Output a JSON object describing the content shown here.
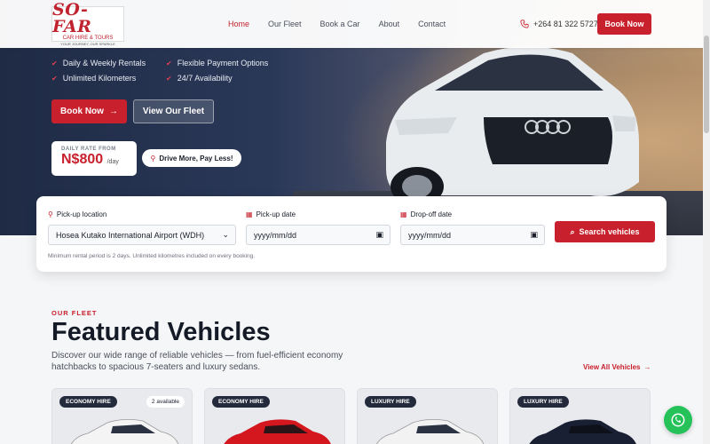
{
  "brand": {
    "logo_text": "SO-FAR",
    "logo_sub": "CAR HIRE & TOURS",
    "logo_tag": "YOUR JOURNEY, OUR SPARKLE"
  },
  "nav": {
    "links": [
      "Home",
      "Our Fleet",
      "Book a Car",
      "About",
      "Contact"
    ],
    "phone": "+264 81 322 5727",
    "cta": "Book Now"
  },
  "hero": {
    "features": [
      "Daily & Weekly Rentals",
      "Flexible Payment Options",
      "Unlimited Kilometers",
      "24/7 Availability"
    ],
    "book_label": "Book Now",
    "fleet_label": "View Our Fleet",
    "rate_label": "DAILY RATE FROM",
    "rate_value": "N$800",
    "rate_unit": "/day",
    "tagline": "Drive More, Pay Less!"
  },
  "search": {
    "pickup_location_label": "Pick-up location",
    "pickup_location_value": "Hosea Kutako International Airport (WDH)",
    "pickup_date_label": "Pick-up date",
    "pickup_date_placeholder": "yyyy/mm/dd",
    "dropoff_date_label": "Drop-off date",
    "dropoff_date_placeholder": "yyyy/mm/dd",
    "submit_label": "Search vehicles",
    "note": "Minimum rental period is 2 days. Unlimited kilometres included on every booking."
  },
  "fleet": {
    "eyebrow": "OUR FLEET",
    "title": "Featured Vehicles",
    "description": "Discover our wide range of reliable vehicles — from fuel-efficient economy hatchbacks to spacious 7-seaters and luxury sedans.",
    "view_all": "View All Vehicles",
    "cards": [
      {
        "badge": "ECONOMY HIRE",
        "availability": "2 available",
        "color": "#f4f4f4"
      },
      {
        "badge": "ECONOMY HIRE",
        "availability": "",
        "color": "#d4161f"
      },
      {
        "badge": "LUXURY HIRE",
        "availability": "",
        "color": "#f2f2f2"
      },
      {
        "badge": "LUXURY HIRE",
        "availability": "",
        "color": "#1a2033"
      }
    ]
  },
  "colors": {
    "accent": "#c8202c",
    "whatsapp": "#25c25a"
  }
}
